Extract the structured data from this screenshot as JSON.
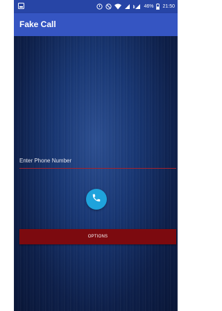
{
  "status_bar": {
    "battery_percent": "46%",
    "time": "21:50",
    "icons": [
      "notification-icon",
      "alarm-icon",
      "silent-icon",
      "wifi-icon",
      "signal-icon",
      "data-signal-icon",
      "battery-icon"
    ]
  },
  "app_bar": {
    "title": "Fake Call",
    "color": "#3555c2"
  },
  "form": {
    "phone_placeholder": "Enter Phone Number",
    "phone_value": "",
    "call_icon": "phone-icon",
    "options_label": "OPTIONS",
    "accent_color": "#1fa3dc",
    "options_color": "#7c0a0f"
  }
}
